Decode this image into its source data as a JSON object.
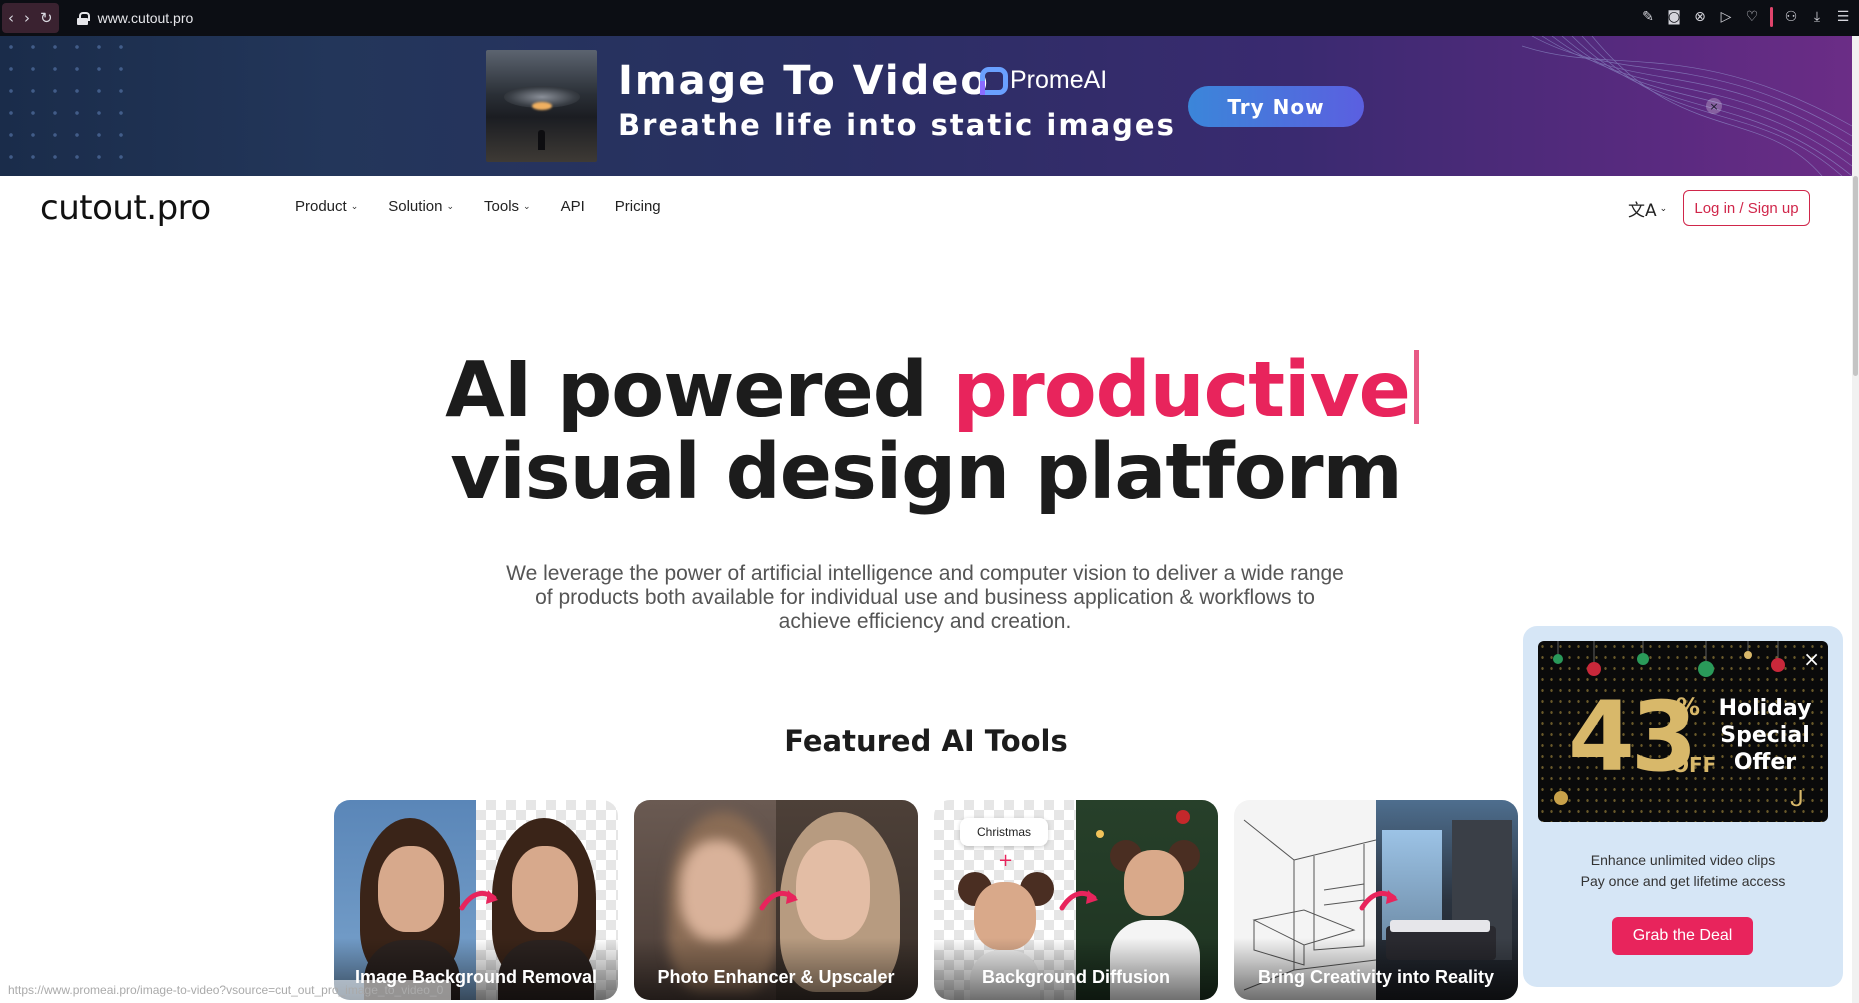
{
  "browser": {
    "url": "www.cutout.pro",
    "back_icon": "chevron-left-icon",
    "forward_icon": "chevron-right-icon",
    "reload_icon": "reload-icon"
  },
  "ad": {
    "title": "Image To Video",
    "brand": "PromeAI",
    "subtitle": "Breathe life into static images",
    "cta": "Try Now",
    "close": "×"
  },
  "nav": {
    "logo": "cutout.pro",
    "items": [
      {
        "label": "Product",
        "chevron": "⌄"
      },
      {
        "label": "Solution",
        "chevron": "⌄"
      },
      {
        "label": "Tools",
        "chevron": "⌄"
      },
      {
        "label": "API"
      },
      {
        "label": "Pricing"
      }
    ],
    "language_glyph": "文A",
    "language_chevron": "⌄",
    "login": "Log in / Sign up"
  },
  "hero": {
    "line1_plain": "AI powered ",
    "line1_accent": "productive",
    "line2": "visual design platform",
    "subtitle": "We leverage the power of artificial intelligence and computer vision to deliver a wide range of products both available for individual use and business application & workflows to achieve efficiency and creation."
  },
  "featured": {
    "heading": "Featured AI Tools",
    "cards": [
      {
        "label": "Image Background Removal"
      },
      {
        "label": "Photo Enhancer & Upscaler"
      },
      {
        "label": "Background Diffusion",
        "tag": "Christmas",
        "plus": "+"
      },
      {
        "label": "Bring Creativity into Reality"
      }
    ]
  },
  "promo": {
    "discount": "43",
    "percent": "%",
    "off": "OFF",
    "headline": "Holiday Special Offer",
    "close": "×",
    "line1": "Enhance unlimited video clips",
    "line2": "Pay once and get lifetime access",
    "cta": "Grab the Deal"
  },
  "status_url": "https://www.promeai.pro/image-to-video?vsource=cut_out_pro_image_to_video_0",
  "colors": {
    "accent": "#e8245c",
    "login_border": "#d0264a",
    "promo_bg": "#d6e6f6"
  }
}
